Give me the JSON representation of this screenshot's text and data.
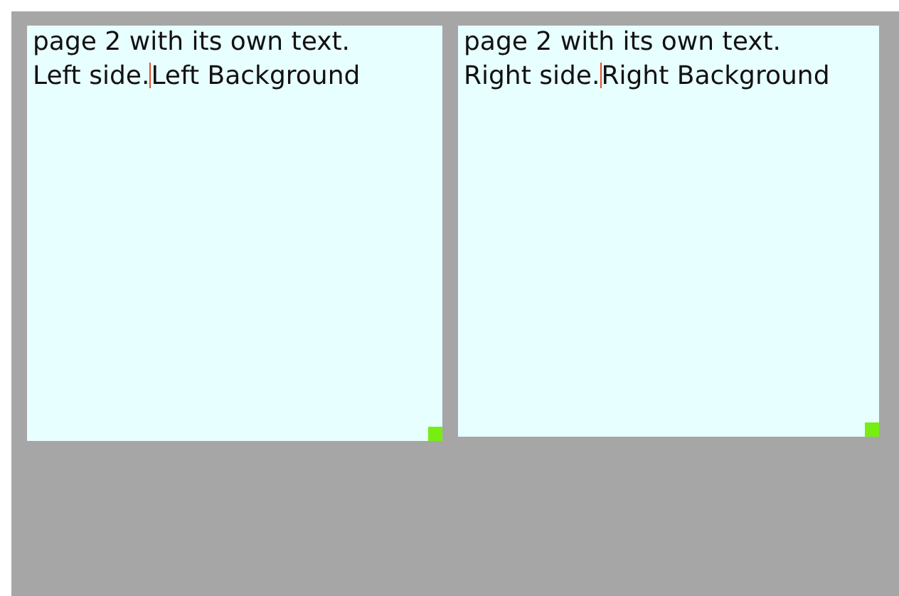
{
  "panels": [
    {
      "first_line": "page 2 with its own text.",
      "before_cursor": "Left side.",
      "after_cursor": "Left Background",
      "cursor": true
    },
    {
      "first_line": "page 2 with its own text.",
      "before_cursor": "Right side.",
      "after_cursor": "Right Background",
      "cursor": true
    }
  ]
}
